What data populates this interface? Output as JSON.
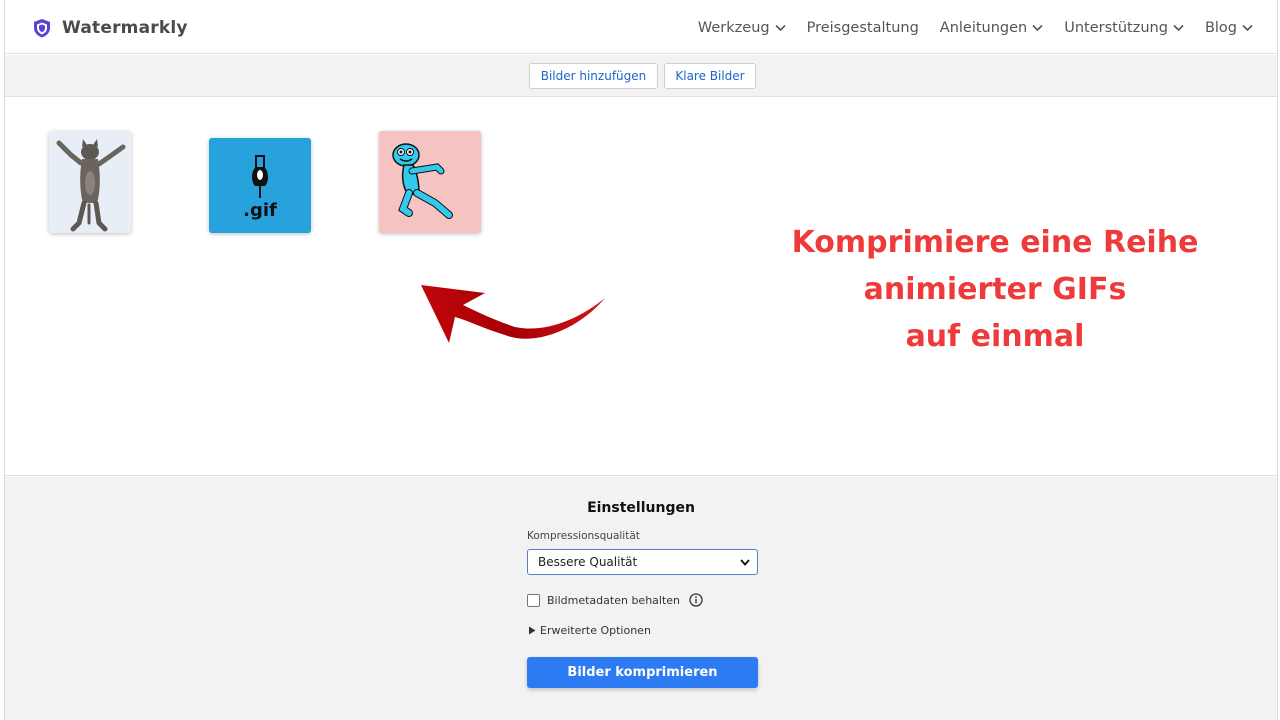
{
  "header": {
    "brand": "Watermarkly",
    "nav": [
      {
        "label": "Werkzeug",
        "dropdown": true
      },
      {
        "label": "Preisgestaltung",
        "dropdown": false
      },
      {
        "label": "Anleitungen",
        "dropdown": true
      },
      {
        "label": "Unterstützung",
        "dropdown": true
      },
      {
        "label": "Blog",
        "dropdown": true
      }
    ]
  },
  "toolbar": {
    "add_label": "Bilder hinzufügen",
    "clear_label": "Klare Bilder"
  },
  "images": [
    {
      "name": "dancing-cat",
      "icon": "cat-image"
    },
    {
      "name": "gif-file",
      "icon": "gif-file-icon",
      "caption": ".gif"
    },
    {
      "name": "dancing-character",
      "icon": "cartoon-image"
    }
  ],
  "promo": {
    "line1": "Komprimiere eine Reihe",
    "line2": "animierter GIFs",
    "line3": "auf einmal"
  },
  "settings": {
    "title": "Einstellungen",
    "quality_label": "Kompressionsqualität",
    "quality_value": "Bessere Qualität",
    "metadata_label": "Bildmetadaten behalten",
    "metadata_checked": false,
    "advanced_label": "Erweiterte Optionen",
    "compress_label": "Bilder komprimieren"
  },
  "colors": {
    "accent": "#2d7bf3",
    "promo": "#ee3a3a",
    "link": "#1b66c9",
    "brand_shield": "#5b3fd6"
  }
}
